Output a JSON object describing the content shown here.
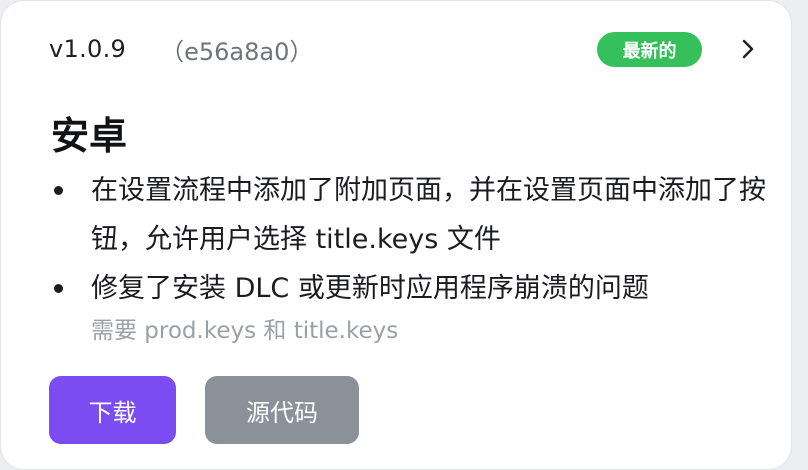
{
  "release": {
    "version": "v1.0.9",
    "commit": "（e56a8a0）",
    "badge": "最新的",
    "badge_color": "#36c05b",
    "expand_icon": "chevron-right-icon"
  },
  "section": {
    "platform": "安卓",
    "notes": [
      "在设置流程中添加了附加页面，并在设置页面中添加了按钮，允许用户选择 title.keys 文件",
      "修复了安装 DLC 或更新时应用程序崩溃的问题"
    ],
    "requirement": "需要 prod.keys 和 title.keys"
  },
  "actions": {
    "download_label": "下载",
    "download_color": "#7a4cf1",
    "source_label": "源代码",
    "source_color": "#8a9199"
  }
}
